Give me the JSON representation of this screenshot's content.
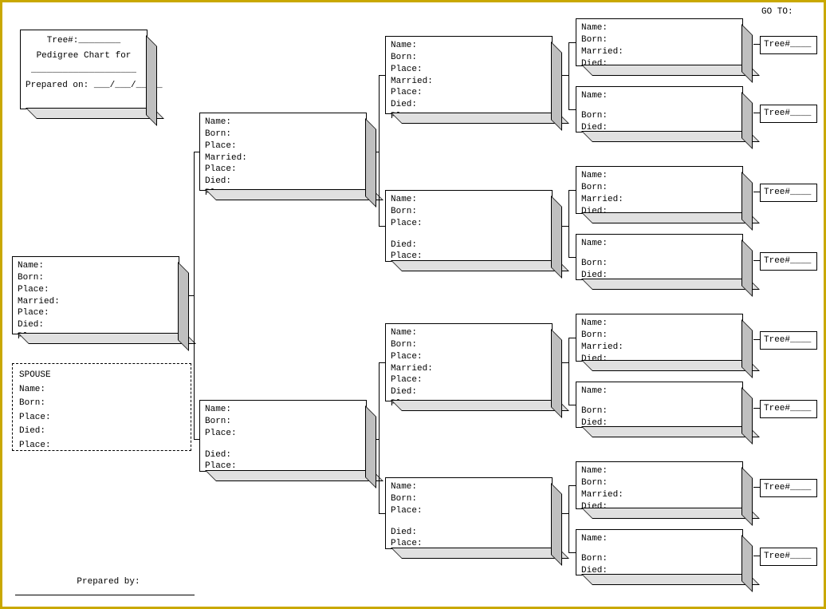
{
  "header": {
    "tree_no_label": "Tree#:________",
    "title": "Pedigree Chart for",
    "name_line": "____________________",
    "prepared_on": "Prepared on: ___/___/_____"
  },
  "goto_label": "GO TO:",
  "prepared_by": "Prepared by:",
  "fields": {
    "name": "Name:",
    "born": "Born:",
    "place": "Place:",
    "married": "Married:",
    "died": "Died:",
    "spouse": "SPOUSE"
  },
  "tree_link": "Tree#____",
  "full7": [
    "Name:",
    "Born:",
    "Place:",
    "Married:",
    "Place:",
    "Died:",
    "Place:"
  ],
  "female5": [
    "Name:",
    "Born:",
    "Place:",
    "",
    "Died:",
    "Place:"
  ],
  "gp4": [
    "Name:",
    "Born:",
    "Married:",
    "Died:"
  ],
  "gp3": [
    "Name:",
    "",
    "Born:",
    "Died:"
  ],
  "spouse_block": [
    "SPOUSE",
    "Name:",
    "",
    "Born:",
    "Place:",
    "Died:",
    "Place:"
  ]
}
